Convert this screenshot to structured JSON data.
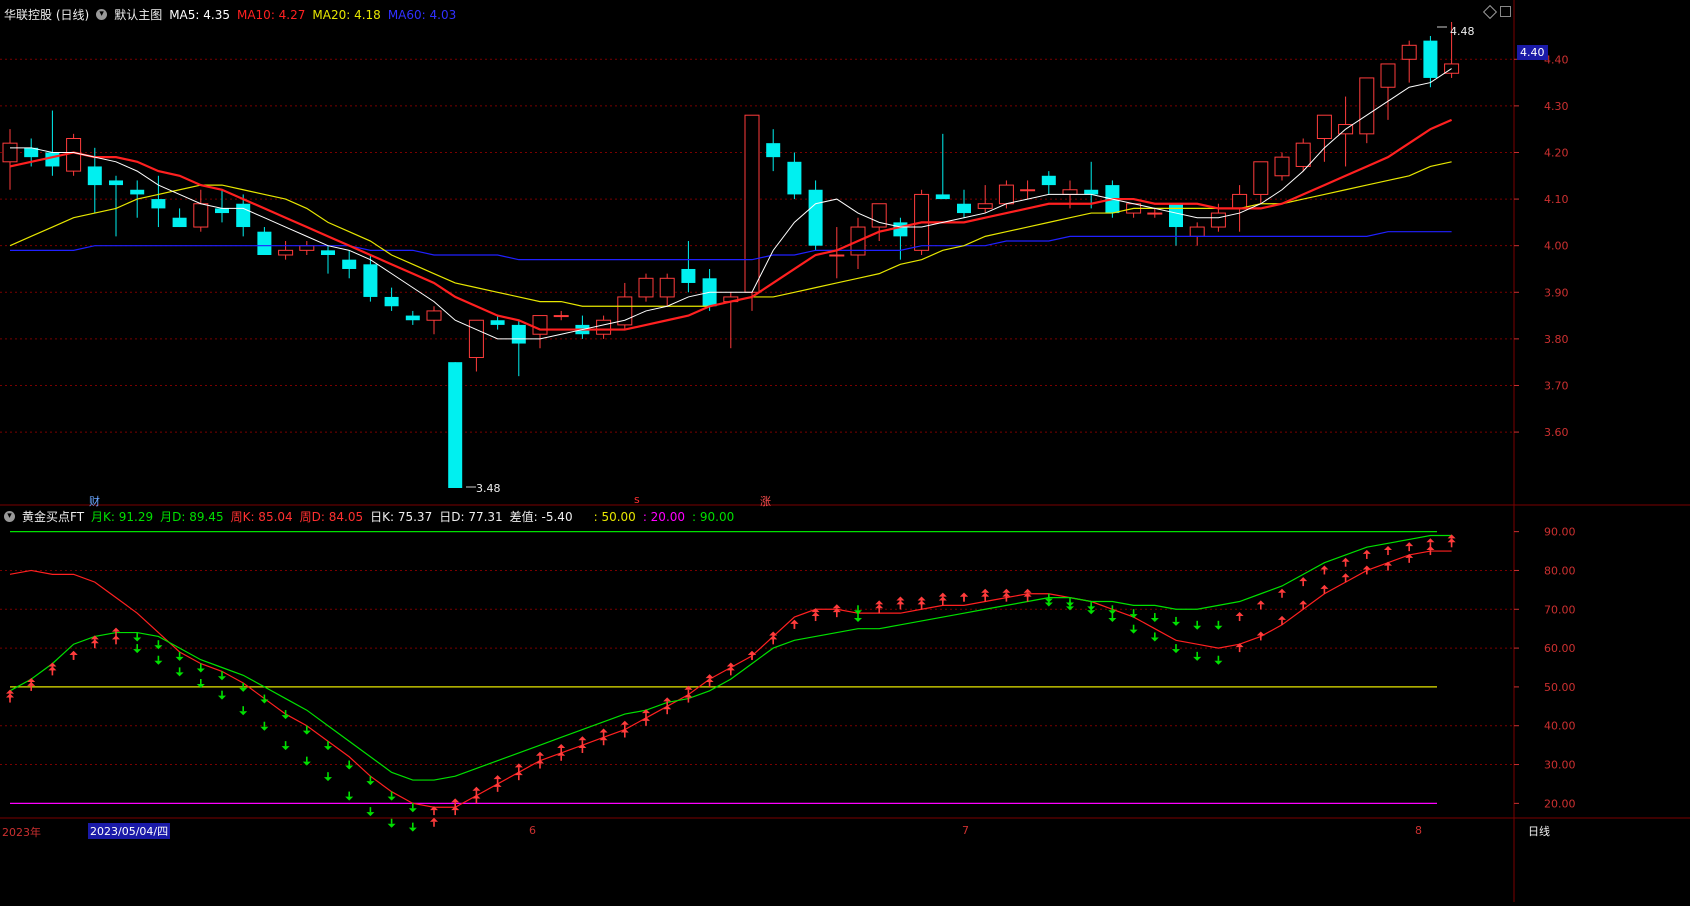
{
  "top_header": {
    "title": "华联控股 (日线)",
    "mode": "默认主图",
    "ma5": "MA5: 4.35",
    "ma10": "MA10: 4.27",
    "ma20": "MA20: 4.18",
    "ma60": "MA60: 4.03"
  },
  "bottom_header": {
    "title": "黄金买点FT",
    "mk": "月K: 91.29",
    "md": "月D: 89.45",
    "wk": "周K: 85.04",
    "wd": "周D: 84.05",
    "dk": "日K: 75.37",
    "dd": "日D: 77.31",
    "diff": "差值: -5.40",
    "l50": ": 50.00",
    "l20": ": 20.00",
    "l90": ": 90.00"
  },
  "colors": {
    "up": "#ff3c3c",
    "down": "#00f0f0",
    "ma5": "#ffffff",
    "ma10": "#ff2020",
    "ma20": "#e6e600",
    "ma60": "#2020ff",
    "grid": "#7a0000",
    "green": "#00e000",
    "yellow": "#e6e600",
    "magenta": "#ff00ff"
  },
  "markers": {
    "cai": "财",
    "s": "s",
    "zhang": "涨",
    "high_label": "4.48",
    "low_label": "3.48",
    "price_box": "4.40"
  },
  "x_axis": {
    "year": "2023年",
    "date": "2023/05/04/四",
    "m6": "6",
    "m7": "7",
    "m8": "8",
    "period": "日线"
  },
  "chart_data": [
    {
      "type": "candlestick",
      "title": "华联控股 (日线)",
      "ylim": [
        3.48,
        4.48
      ],
      "y_ticks": [
        "4.40",
        "4.30",
        "4.20",
        "4.10",
        "4.00",
        "3.90",
        "3.80",
        "3.70",
        "3.60"
      ],
      "y_tick_values": [
        4.4,
        4.3,
        4.2,
        4.1,
        4.0,
        3.9,
        3.8,
        3.7,
        3.6
      ],
      "ohlc": [
        [
          4.18,
          4.25,
          4.12,
          4.22
        ],
        [
          4.21,
          4.23,
          4.17,
          4.19
        ],
        [
          4.2,
          4.29,
          4.15,
          4.17
        ],
        [
          4.16,
          4.24,
          4.15,
          4.23
        ],
        [
          4.17,
          4.21,
          4.07,
          4.13
        ],
        [
          4.14,
          4.15,
          4.02,
          4.13
        ],
        [
          4.12,
          4.14,
          4.06,
          4.11
        ],
        [
          4.1,
          4.15,
          4.04,
          4.08
        ],
        [
          4.06,
          4.08,
          4.04,
          4.04
        ],
        [
          4.04,
          4.12,
          4.03,
          4.09
        ],
        [
          4.08,
          4.12,
          4.05,
          4.07
        ],
        [
          4.09,
          4.11,
          4.02,
          4.04
        ],
        [
          4.03,
          4.04,
          3.98,
          3.98
        ],
        [
          3.98,
          4.01,
          3.97,
          3.99
        ],
        [
          3.99,
          4.01,
          3.98,
          4.0
        ],
        [
          3.99,
          4.0,
          3.94,
          3.98
        ],
        [
          3.97,
          3.99,
          3.93,
          3.95
        ],
        [
          3.96,
          3.98,
          3.88,
          3.89
        ],
        [
          3.89,
          3.91,
          3.86,
          3.87
        ],
        [
          3.85,
          3.86,
          3.83,
          3.84
        ],
        [
          3.84,
          3.87,
          3.81,
          3.86
        ],
        [
          3.75,
          3.75,
          3.48,
          3.48
        ],
        [
          3.76,
          3.84,
          3.73,
          3.84
        ],
        [
          3.84,
          3.85,
          3.82,
          3.83
        ],
        [
          3.83,
          3.84,
          3.72,
          3.79
        ],
        [
          3.81,
          3.85,
          3.78,
          3.85
        ],
        [
          3.85,
          3.86,
          3.84,
          3.85
        ],
        [
          3.83,
          3.85,
          3.8,
          3.81
        ],
        [
          3.81,
          3.85,
          3.8,
          3.84
        ],
        [
          3.83,
          3.92,
          3.82,
          3.89
        ],
        [
          3.89,
          3.94,
          3.88,
          3.93
        ],
        [
          3.89,
          3.94,
          3.87,
          3.93
        ],
        [
          3.95,
          4.01,
          3.9,
          3.92
        ],
        [
          3.93,
          3.95,
          3.86,
          3.87
        ],
        [
          3.88,
          3.9,
          3.78,
          3.89
        ],
        [
          3.9,
          4.28,
          3.86,
          4.28
        ],
        [
          4.22,
          4.25,
          4.16,
          4.19
        ],
        [
          4.18,
          4.2,
          4.1,
          4.11
        ],
        [
          4.12,
          4.14,
          3.99,
          4.0
        ],
        [
          3.98,
          4.04,
          3.93,
          3.98
        ],
        [
          3.98,
          4.06,
          3.95,
          4.04
        ],
        [
          4.04,
          4.09,
          4.01,
          4.09
        ],
        [
          4.05,
          4.06,
          3.97,
          4.02
        ],
        [
          3.99,
          4.12,
          3.98,
          4.11
        ],
        [
          4.11,
          4.24,
          4.1,
          4.1
        ],
        [
          4.09,
          4.12,
          4.06,
          4.07
        ],
        [
          4.08,
          4.13,
          4.07,
          4.09
        ],
        [
          4.09,
          4.14,
          4.08,
          4.13
        ],
        [
          4.12,
          4.14,
          4.1,
          4.12
        ],
        [
          4.15,
          4.16,
          4.11,
          4.13
        ],
        [
          4.11,
          4.14,
          4.08,
          4.12
        ],
        [
          4.12,
          4.18,
          4.08,
          4.11
        ],
        [
          4.13,
          4.14,
          4.06,
          4.07
        ],
        [
          4.07,
          4.09,
          4.06,
          4.09
        ],
        [
          4.07,
          4.08,
          4.06,
          4.07
        ],
        [
          4.09,
          4.09,
          4.0,
          4.04
        ],
        [
          4.02,
          4.05,
          4.0,
          4.04
        ],
        [
          4.04,
          4.09,
          4.03,
          4.07
        ],
        [
          4.08,
          4.13,
          4.03,
          4.11
        ],
        [
          4.11,
          4.18,
          4.09,
          4.18
        ],
        [
          4.15,
          4.2,
          4.14,
          4.19
        ],
        [
          4.17,
          4.23,
          4.16,
          4.22
        ],
        [
          4.23,
          4.26,
          4.18,
          4.28
        ],
        [
          4.24,
          4.32,
          4.17,
          4.26
        ],
        [
          4.24,
          4.33,
          4.22,
          4.36
        ],
        [
          4.34,
          4.38,
          4.27,
          4.39
        ],
        [
          4.4,
          4.44,
          4.35,
          4.43
        ],
        [
          4.44,
          4.45,
          4.34,
          4.36
        ],
        [
          4.37,
          4.48,
          4.36,
          4.39
        ]
      ],
      "ma5": [
        4.21,
        4.21,
        4.2,
        4.2,
        4.19,
        4.18,
        4.16,
        4.13,
        4.11,
        4.09,
        4.08,
        4.08,
        4.06,
        4.04,
        4.02,
        4.0,
        3.99,
        3.97,
        3.94,
        3.91,
        3.88,
        3.84,
        3.82,
        3.8,
        3.8,
        3.8,
        3.81,
        3.82,
        3.83,
        3.84,
        3.86,
        3.87,
        3.89,
        3.9,
        3.9,
        3.9,
        3.99,
        4.05,
        4.09,
        4.1,
        4.07,
        4.05,
        4.04,
        4.04,
        4.05,
        4.06,
        4.07,
        4.09,
        4.1,
        4.11,
        4.11,
        4.11,
        4.1,
        4.09,
        4.08,
        4.07,
        4.06,
        4.06,
        4.07,
        4.09,
        4.12,
        4.16,
        4.21,
        4.25,
        4.28,
        4.31,
        4.34,
        4.35,
        4.38
      ],
      "ma10": [
        4.17,
        4.18,
        4.19,
        4.2,
        4.19,
        4.19,
        4.18,
        4.16,
        4.15,
        4.13,
        4.12,
        4.1,
        4.08,
        4.06,
        4.04,
        4.02,
        4.0,
        3.98,
        3.96,
        3.94,
        3.92,
        3.89,
        3.87,
        3.85,
        3.84,
        3.82,
        3.82,
        3.82,
        3.82,
        3.82,
        3.83,
        3.84,
        3.85,
        3.87,
        3.88,
        3.89,
        3.92,
        3.95,
        3.98,
        3.99,
        4.01,
        4.03,
        4.04,
        4.05,
        4.05,
        4.05,
        4.06,
        4.07,
        4.08,
        4.09,
        4.09,
        4.09,
        4.1,
        4.1,
        4.09,
        4.09,
        4.09,
        4.08,
        4.08,
        4.08,
        4.09,
        4.11,
        4.13,
        4.15,
        4.17,
        4.19,
        4.22,
        4.25,
        4.27
      ],
      "ma20": [
        4.0,
        4.02,
        4.04,
        4.06,
        4.07,
        4.08,
        4.1,
        4.11,
        4.12,
        4.13,
        4.13,
        4.12,
        4.11,
        4.1,
        4.08,
        4.05,
        4.03,
        4.01,
        3.98,
        3.96,
        3.94,
        3.92,
        3.91,
        3.9,
        3.89,
        3.88,
        3.88,
        3.87,
        3.87,
        3.87,
        3.87,
        3.87,
        3.87,
        3.87,
        3.88,
        3.89,
        3.89,
        3.9,
        3.91,
        3.92,
        3.93,
        3.94,
        3.96,
        3.97,
        3.99,
        4.0,
        4.02,
        4.03,
        4.04,
        4.05,
        4.06,
        4.07,
        4.07,
        4.08,
        4.08,
        4.08,
        4.08,
        4.08,
        4.08,
        4.09,
        4.09,
        4.1,
        4.11,
        4.12,
        4.13,
        4.14,
        4.15,
        4.17,
        4.18
      ],
      "ma60": [
        3.99,
        3.99,
        3.99,
        3.99,
        4.0,
        4.0,
        4.0,
        4.0,
        4.0,
        4.0,
        4.0,
        4.0,
        4.0,
        4.0,
        4.0,
        4.0,
        4.0,
        3.99,
        3.99,
        3.99,
        3.98,
        3.98,
        3.98,
        3.98,
        3.97,
        3.97,
        3.97,
        3.97,
        3.97,
        3.97,
        3.97,
        3.97,
        3.97,
        3.97,
        3.97,
        3.97,
        3.98,
        3.98,
        3.99,
        3.99,
        3.99,
        3.99,
        3.99,
        4.0,
        4.0,
        4.0,
        4.0,
        4.01,
        4.01,
        4.01,
        4.02,
        4.02,
        4.02,
        4.02,
        4.02,
        4.02,
        4.02,
        4.02,
        4.02,
        4.02,
        4.02,
        4.02,
        4.02,
        4.02,
        4.02,
        4.03,
        4.03,
        4.03,
        4.03
      ]
    },
    {
      "type": "line",
      "title": "黄金买点FT",
      "ylim": [
        17,
        93
      ],
      "y_ticks": [
        "90.00",
        "80.00",
        "70.00",
        "60.00",
        "50.00",
        "40.00",
        "30.00",
        "20.00"
      ],
      "y_tick_values": [
        90,
        80,
        70,
        60,
        50,
        40,
        30,
        20
      ],
      "levels": [
        50,
        20,
        90
      ],
      "series": [
        {
          "name": "周K",
          "values": [
            79,
            80,
            79,
            79,
            77,
            73,
            69,
            64,
            59,
            56,
            54,
            51,
            47,
            43,
            40,
            36,
            32,
            27,
            23,
            20,
            19,
            19,
            22,
            25,
            28,
            31,
            33,
            35,
            37,
            39,
            42,
            45,
            48,
            52,
            55,
            58,
            63,
            68,
            70,
            70,
            69,
            69,
            69,
            70,
            71,
            71,
            72,
            73,
            74,
            74,
            73,
            72,
            70,
            68,
            65,
            62,
            61,
            60,
            61,
            63,
            66,
            70,
            74,
            77,
            80,
            82,
            84,
            85,
            85
          ]
        },
        {
          "name": "周D",
          "values": [
            49,
            52,
            56,
            61,
            63,
            64,
            64,
            63,
            60,
            57,
            55,
            53,
            50,
            47,
            44,
            40,
            36,
            32,
            28,
            26,
            26,
            27,
            29,
            31,
            33,
            35,
            37,
            39,
            41,
            43,
            44,
            46,
            47,
            49,
            52,
            56,
            60,
            62,
            63,
            64,
            65,
            65,
            66,
            67,
            68,
            69,
            70,
            71,
            72,
            73,
            73,
            72,
            72,
            71,
            71,
            70,
            70,
            71,
            72,
            74,
            76,
            79,
            82,
            84,
            86,
            87,
            88,
            89,
            89
          ]
        },
        {
          "name": "日K",
          "values": [
            47,
            50,
            54,
            58,
            61,
            62,
            60,
            57,
            54,
            51,
            48,
            44,
            40,
            35,
            31,
            27,
            22,
            18,
            15,
            14,
            15,
            18,
            21,
            24,
            27,
            30,
            32,
            34,
            36,
            38,
            41,
            44,
            47,
            51,
            54,
            58,
            62,
            66,
            68,
            69,
            68,
            70,
            71,
            71,
            72,
            73,
            73,
            73,
            73,
            72,
            71,
            70,
            68,
            65,
            63,
            60,
            58,
            57,
            60,
            63,
            67,
            71,
            75,
            78,
            80,
            81,
            83,
            85,
            87
          ]
        },
        {
          "name": "日D",
          "values": [
            48,
            51,
            55,
            58,
            62,
            64,
            63,
            61,
            58,
            55,
            53,
            50,
            47,
            43,
            39,
            35,
            30,
            26,
            22,
            19,
            18,
            20,
            23,
            26,
            29,
            32,
            34,
            36,
            38,
            40,
            43,
            46,
            49,
            52,
            55,
            58,
            63,
            66,
            69,
            70,
            70,
            71,
            72,
            72,
            73,
            73,
            74,
            74,
            74,
            73,
            72,
            71,
            70,
            69,
            68,
            67,
            66,
            66,
            68,
            71,
            74,
            77,
            80,
            82,
            84,
            85,
            86,
            87,
            88
          ]
        }
      ]
    }
  ]
}
